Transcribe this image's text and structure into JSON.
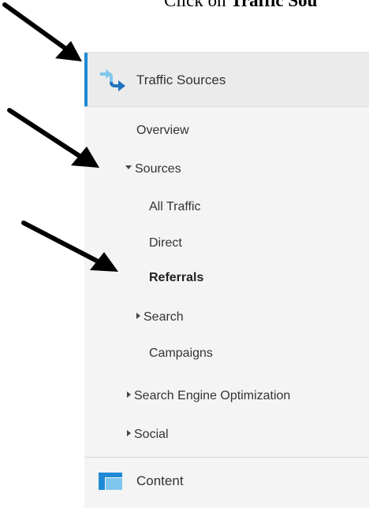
{
  "instruction": {
    "prefix": "Click on",
    "bold_text": "Traffic Sou"
  },
  "sidebar": {
    "section_title": "Traffic Sources",
    "items": [
      {
        "label": "Overview"
      },
      {
        "label": "Sources",
        "state": "expanded"
      },
      {
        "label": "All Traffic"
      },
      {
        "label": "Direct"
      },
      {
        "label": "Referrals",
        "selected": true
      },
      {
        "label": "Search",
        "state": "collapsed"
      },
      {
        "label": "Campaigns"
      },
      {
        "label": "Search Engine Optimization",
        "state": "collapsed"
      },
      {
        "label": "Social",
        "state": "collapsed"
      }
    ],
    "next_section": "Content"
  },
  "colors": {
    "accent": "#1e8ad6",
    "sidebar_bg": "#f4f4f4",
    "active_bg": "#ebebeb"
  },
  "icons": {
    "traffic": "traffic-sources-arrows-icon",
    "content": "content-layout-icon",
    "pointer": "black-pointer-arrow"
  }
}
